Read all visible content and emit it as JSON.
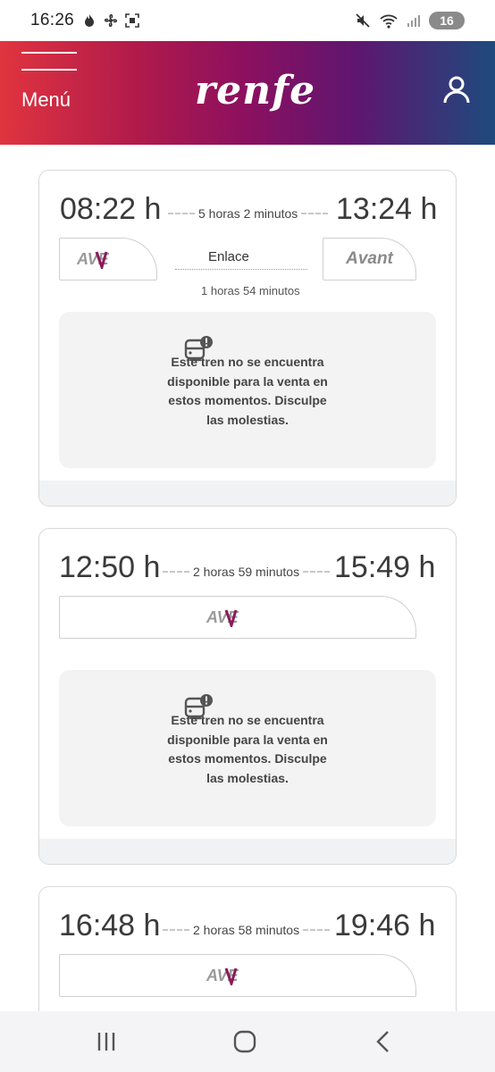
{
  "status_bar": {
    "time": "16:26",
    "battery": "16"
  },
  "header": {
    "menu_label": "Menú",
    "logo_text": "renfe"
  },
  "trips": [
    {
      "departure": "08:22 h",
      "duration": "5 horas 2 minutos",
      "arrival": "13:24 h",
      "legs": [
        "AVE",
        "Avant"
      ],
      "connection_label": "Enlace",
      "connection_duration": "1 horas 54 minutos",
      "notice": "Este tren no se encuentra disponible para la venta en estos momentos. Disculpe las molestias."
    },
    {
      "departure": "12:50 h",
      "duration": "2 horas 59 minutos",
      "arrival": "15:49 h",
      "legs": [
        "AVE"
      ],
      "notice": "Este tren no se encuentra disponible para la venta en estos momentos. Disculpe las molestias."
    },
    {
      "departure": "16:48 h",
      "duration": "2 horas 58 minutos",
      "arrival": "19:46 h",
      "legs": [
        "AVE"
      ]
    }
  ],
  "colors": {
    "ave_accent": "#8b1a5a",
    "header_start": "#e0343f",
    "header_end": "#1e4a7e"
  },
  "icons": [
    "menu-icon",
    "user-icon",
    "ticket-alert-icon",
    "recent-apps-icon",
    "home-icon",
    "back-icon"
  ]
}
